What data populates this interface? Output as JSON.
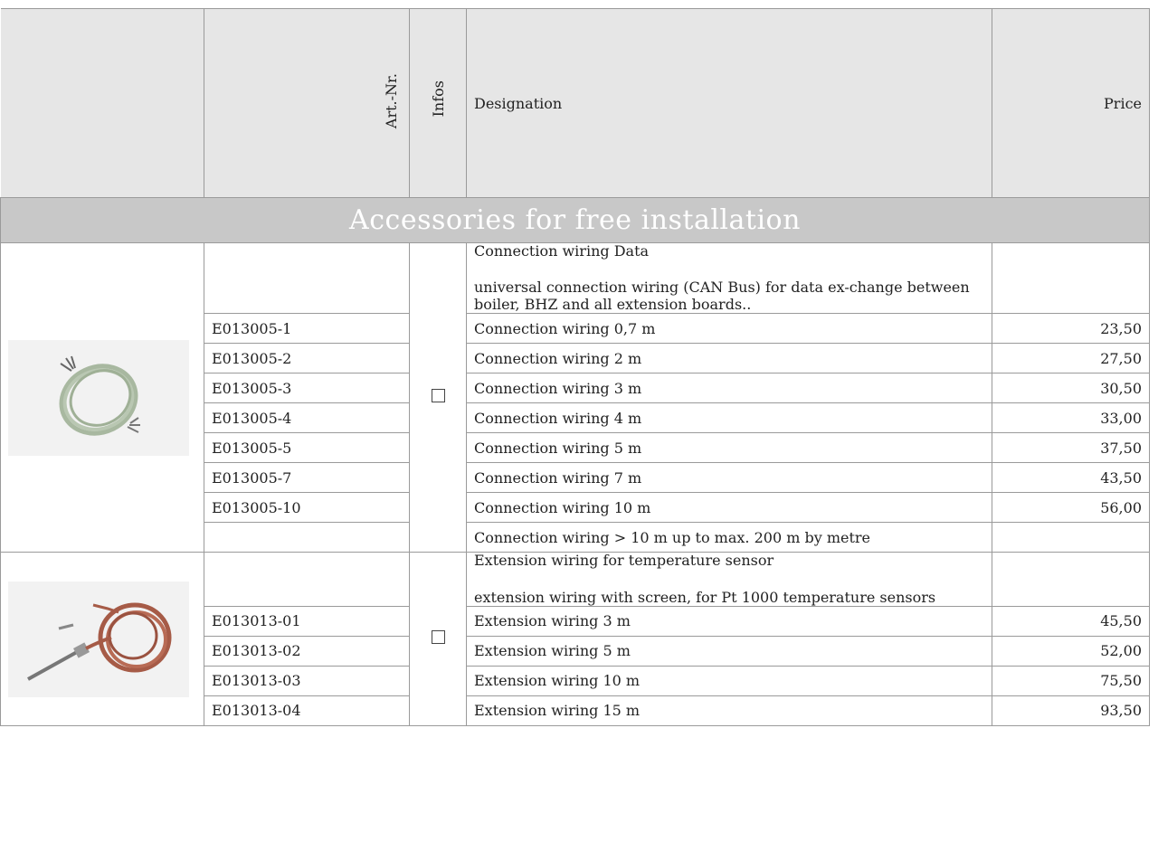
{
  "header": {
    "art_nr": "Art.-Nr.",
    "infos": "Infos",
    "designation": "Designation",
    "price": "Price"
  },
  "section_title": "Accessories for free installation",
  "groups": [
    {
      "image": "cable-coil-grey",
      "title": "Connection wiring Data",
      "description": "universal connection wiring (CAN Bus) for data ex-change between boiler, BHZ and all extension boards..",
      "rows": [
        {
          "art": "E013005-1",
          "desc": "Connection wiring 0,7 m",
          "price": "23,50"
        },
        {
          "art": "E013005-2",
          "desc": "Connection wiring 2 m",
          "price": "27,50"
        },
        {
          "art": "E013005-3",
          "desc": "Connection wiring 3 m",
          "price": "30,50"
        },
        {
          "art": "E013005-4",
          "desc": "Connection wiring 4 m",
          "price": "33,00"
        },
        {
          "art": "E013005-5",
          "desc": "Connection wiring 5 m",
          "price": "37,50"
        },
        {
          "art": "E013005-7",
          "desc": "Connection wiring 7 m",
          "price": "43,50"
        },
        {
          "art": "E013005-10",
          "desc": "Connection wiring 10 m",
          "price": "56,00"
        },
        {
          "art": "",
          "desc": "Connection wiring > 10 m up to max. 200 m by metre",
          "price": ""
        }
      ]
    },
    {
      "image": "temperature-sensor-cable-red",
      "title": "Extension wiring for temperature sensor",
      "description": "extension wiring with screen, for Pt 1000 temperature sensors",
      "rows": [
        {
          "art": "E013013-01",
          "desc": "Extension wiring 3 m",
          "price": "45,50"
        },
        {
          "art": "E013013-02",
          "desc": "Extension wiring 5 m",
          "price": "52,00"
        },
        {
          "art": "E013013-03",
          "desc": "Extension wiring 10 m",
          "price": "75,50"
        },
        {
          "art": "E013013-04",
          "desc": "Extension wiring 15 m",
          "price": "93,50"
        }
      ]
    }
  ]
}
